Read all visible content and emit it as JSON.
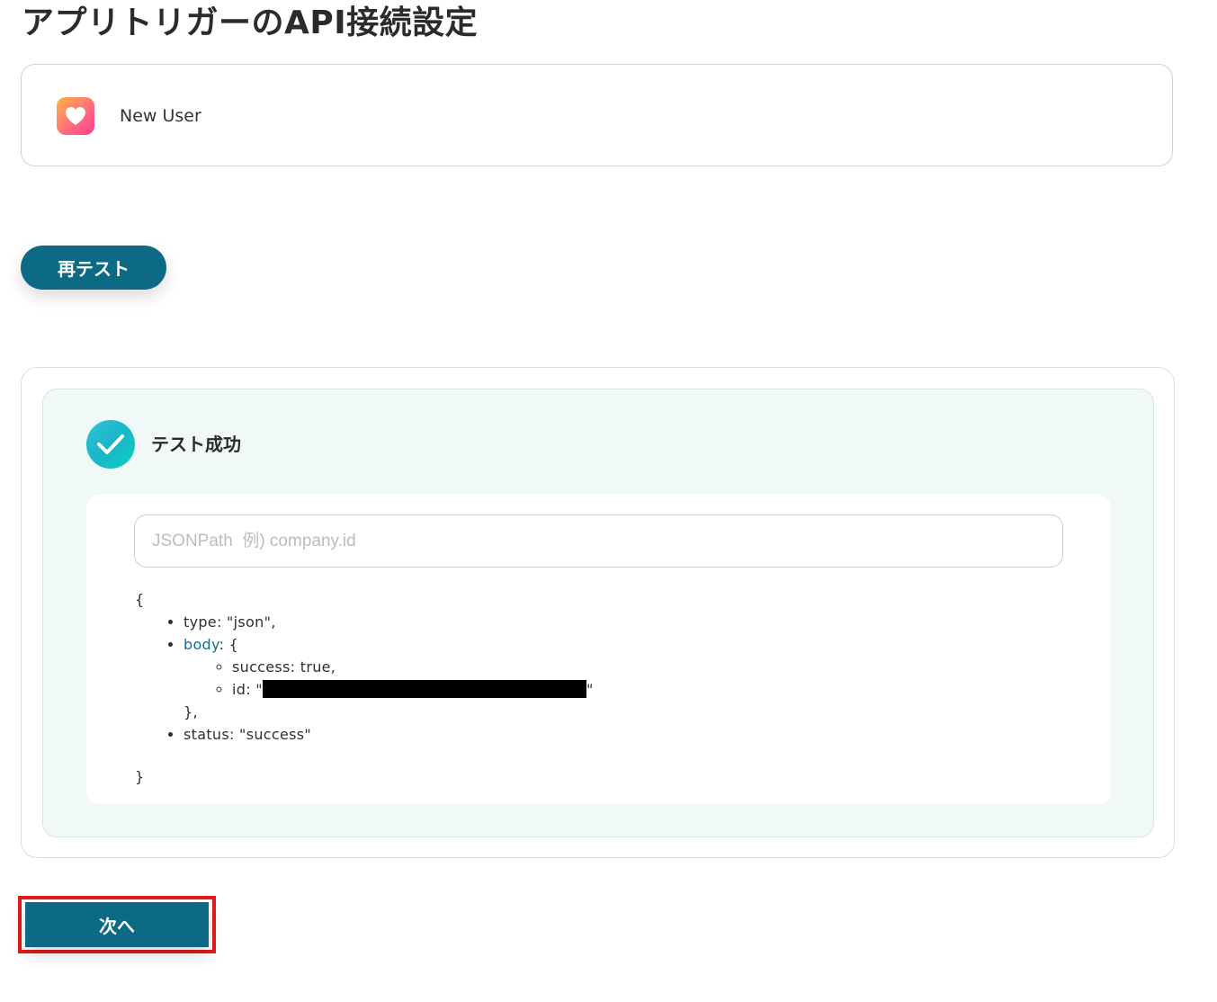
{
  "page": {
    "title": "アプリトリガーのAPI接続設定"
  },
  "trigger": {
    "icon": "heart-icon",
    "name": "New User"
  },
  "retest": {
    "label": "再テスト"
  },
  "result": {
    "status_icon": "check-circle-icon",
    "status_label": "テスト成功",
    "jsonpath": {
      "value": "",
      "placeholder": "JSONPath  例) company.id"
    },
    "json": {
      "open_brace": "{",
      "close_brace": "}",
      "type_line": "type: \"json\",",
      "body_key": "body",
      "body_open": ": {",
      "success_line": "success: true,",
      "id_prefix": "id: \"",
      "id_suffix": "\"",
      "body_close": "},",
      "status_line": "status: \"success\""
    }
  },
  "footer": {
    "next_label": "次へ"
  },
  "colors": {
    "primary": "#0d6a84",
    "success_teal": "#19b5c9",
    "highlight_red": "#e11b1b",
    "result_background": "#f1f9f8"
  }
}
